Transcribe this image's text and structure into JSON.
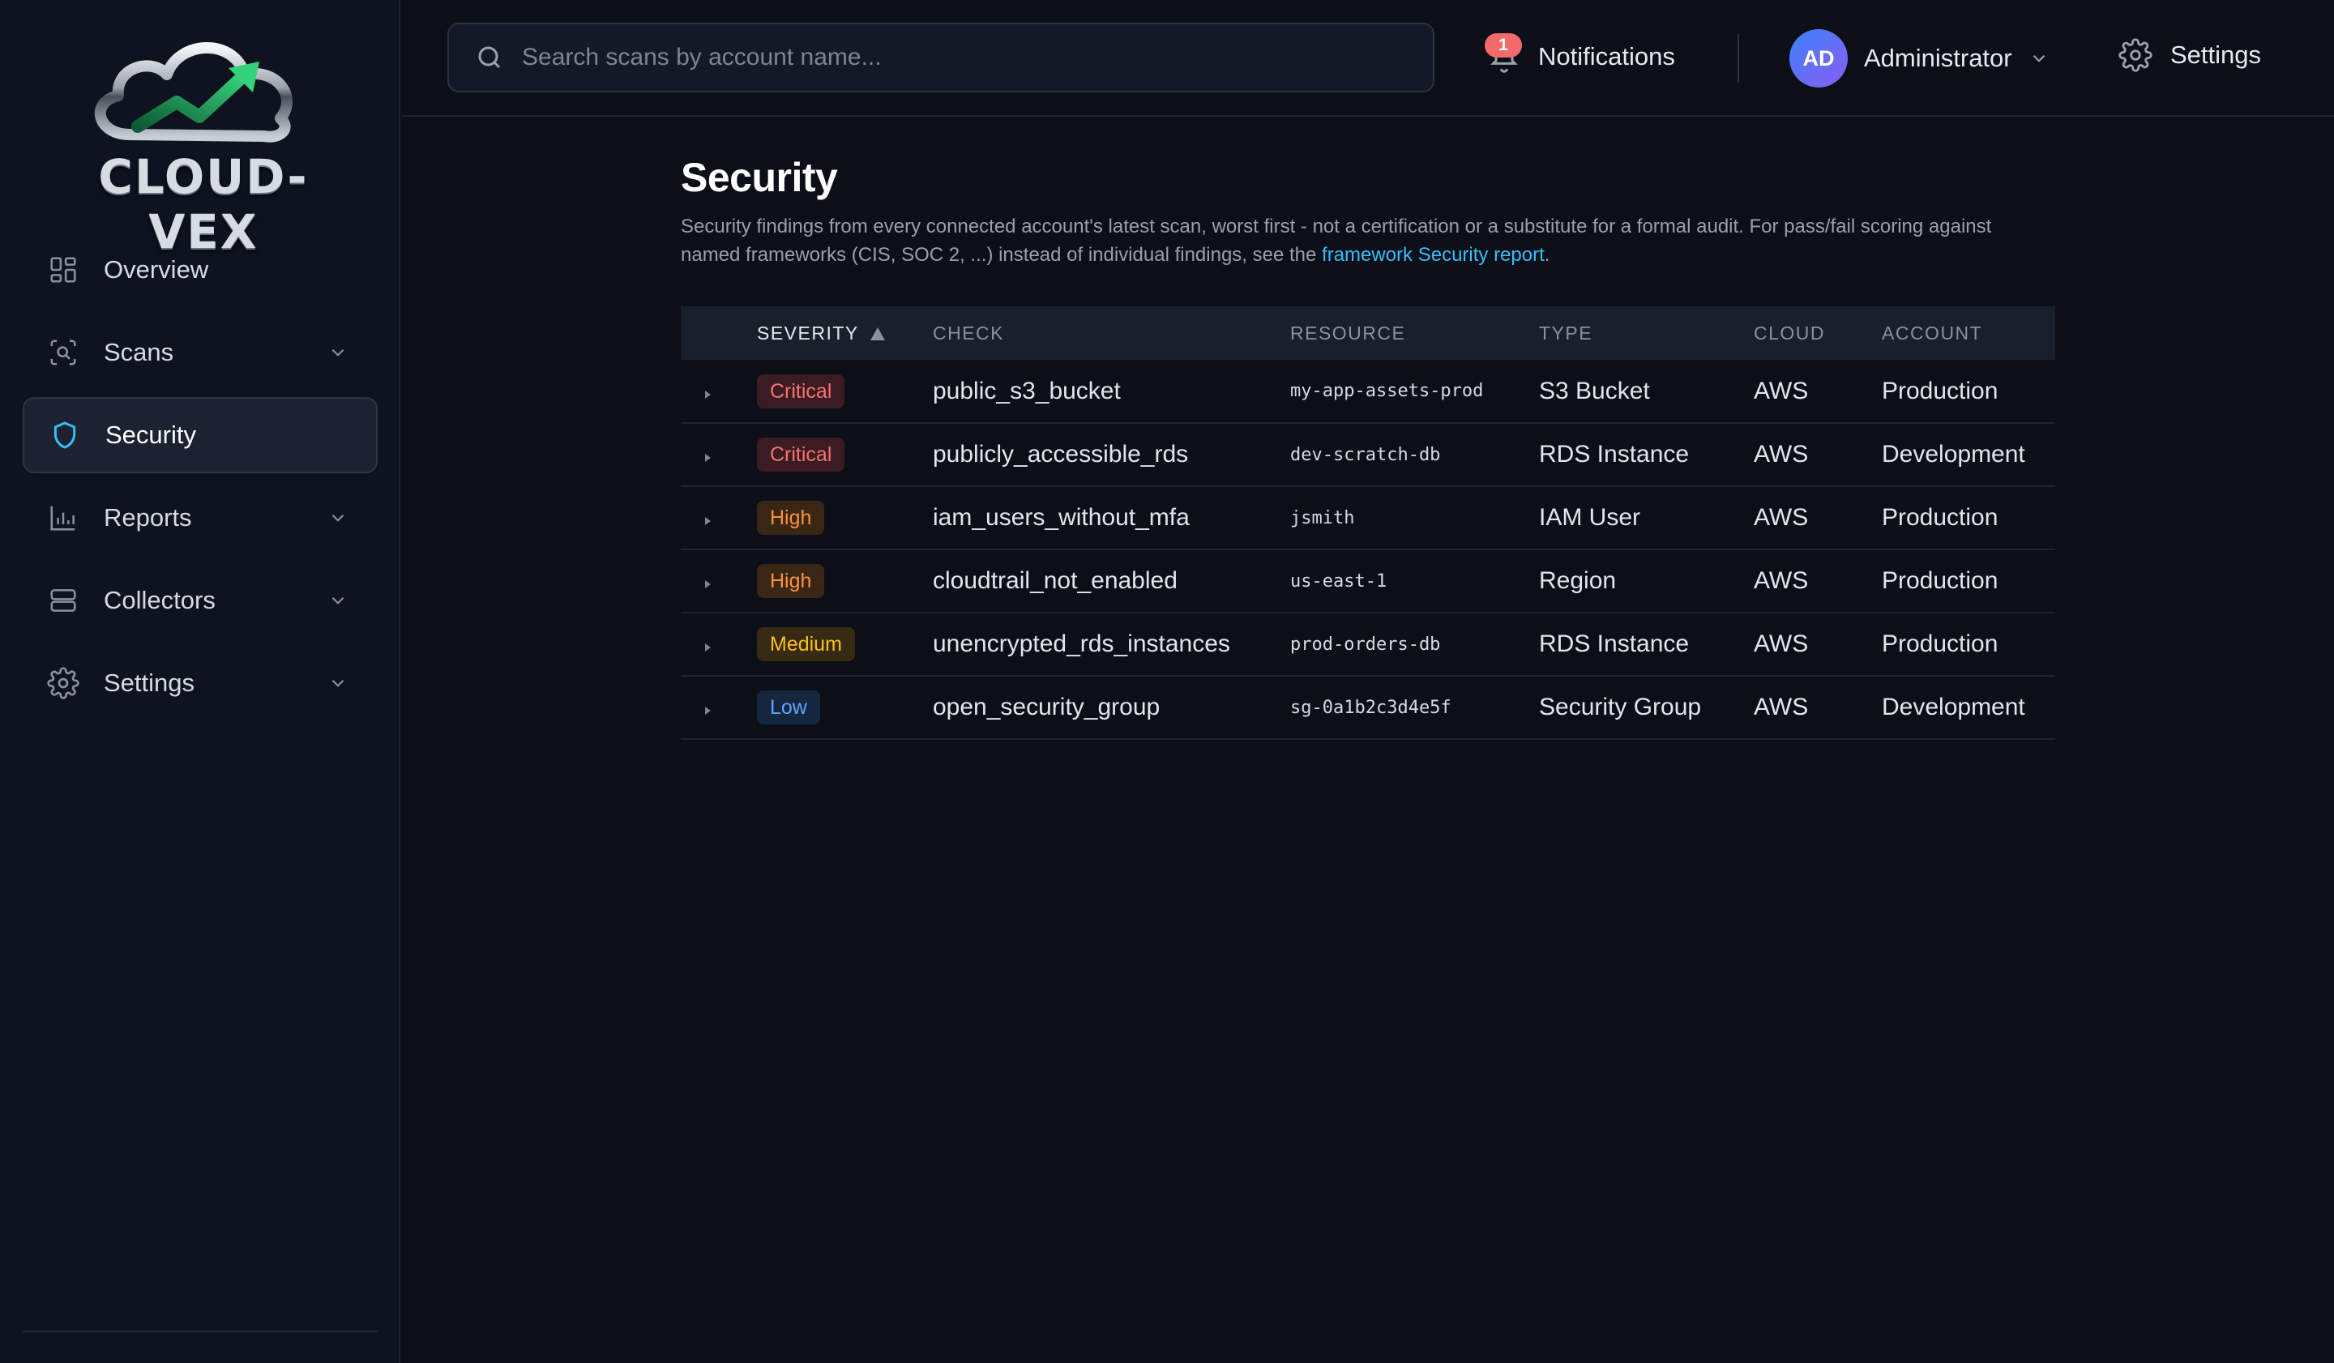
{
  "brand": {
    "name": "CLOUD-VEX"
  },
  "sidebar": {
    "items": [
      {
        "label": "Overview",
        "icon": "dashboard-grid-icon",
        "active": false,
        "expandable": false
      },
      {
        "label": "Scans",
        "icon": "scan-search-icon",
        "active": false,
        "expandable": true
      },
      {
        "label": "Security",
        "icon": "shield-icon",
        "active": true,
        "expandable": false
      },
      {
        "label": "Reports",
        "icon": "bar-chart-icon",
        "active": false,
        "expandable": true
      },
      {
        "label": "Collectors",
        "icon": "server-icon",
        "active": false,
        "expandable": true
      },
      {
        "label": "Settings",
        "icon": "gear-icon",
        "active": false,
        "expandable": true
      }
    ]
  },
  "topbar": {
    "search_placeholder": "Search scans by account name...",
    "notifications": {
      "label": "Notifications",
      "count": "1"
    },
    "user": {
      "initials": "AD",
      "name": "Administrator"
    },
    "settings_label": "Settings"
  },
  "page": {
    "title": "Security",
    "description_before": "Security findings from every connected account's latest scan, worst first - not a certification or a substitute for a formal audit. For pass/fail scoring against named frameworks (CIS, SOC 2, ...) instead of individual findings, see the ",
    "description_link": "framework Security report",
    "description_after": "."
  },
  "table": {
    "columns": [
      "SEVERITY",
      "CHECK",
      "RESOURCE",
      "TYPE",
      "CLOUD",
      "ACCOUNT"
    ],
    "sorted_column": "SEVERITY",
    "rows": [
      {
        "severity": "Critical",
        "check": "public_s3_bucket",
        "resource": "my-app-assets-prod",
        "type": "S3 Bucket",
        "cloud": "AWS",
        "account": "Production"
      },
      {
        "severity": "Critical",
        "check": "publicly_accessible_rds",
        "resource": "dev-scratch-db",
        "type": "RDS Instance",
        "cloud": "AWS",
        "account": "Development"
      },
      {
        "severity": "High",
        "check": "iam_users_without_mfa",
        "resource": "jsmith",
        "type": "IAM User",
        "cloud": "AWS",
        "account": "Production"
      },
      {
        "severity": "High",
        "check": "cloudtrail_not_enabled",
        "resource": "us-east-1",
        "type": "Region",
        "cloud": "AWS",
        "account": "Production"
      },
      {
        "severity": "Medium",
        "check": "unencrypted_rds_instances",
        "resource": "prod-orders-db",
        "type": "RDS Instance",
        "cloud": "AWS",
        "account": "Production"
      },
      {
        "severity": "Low",
        "check": "open_security_group",
        "resource": "sg-0a1b2c3d4e5f",
        "type": "Security Group",
        "cloud": "AWS",
        "account": "Development"
      }
    ]
  },
  "severity_colors": {
    "Critical": {
      "text": "#f87171",
      "bg": "#3a1c22"
    },
    "High": {
      "text": "#fb923c",
      "bg": "#3a2614"
    },
    "Medium": {
      "text": "#fbbf24",
      "bg": "#362b12"
    },
    "Low": {
      "text": "#60a5fa",
      "bg": "#15273f"
    }
  },
  "colors": {
    "accent": "#38bdf8",
    "background": "#0c0f18",
    "sidebar": "#0f1320"
  }
}
